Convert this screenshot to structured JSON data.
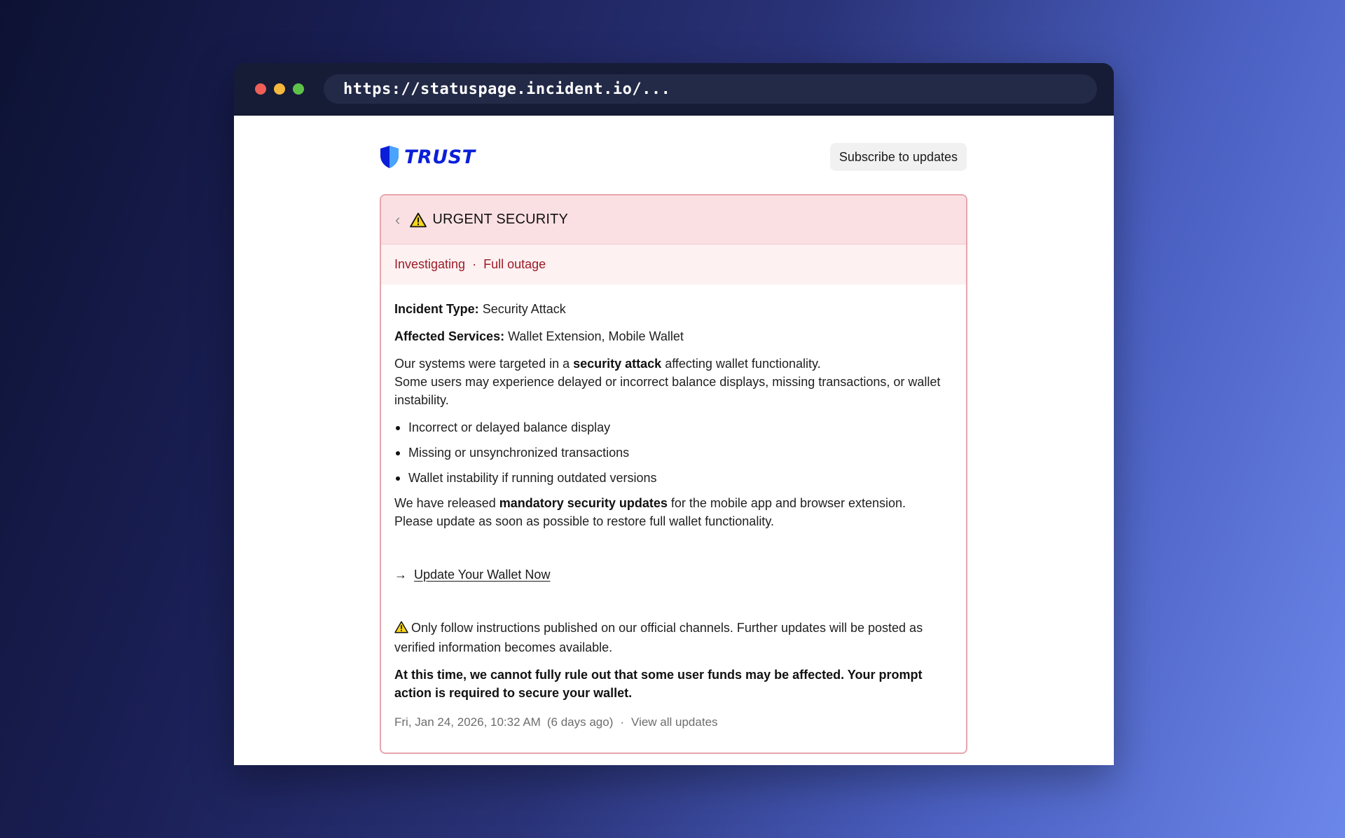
{
  "browser": {
    "url": "https://statuspage.incident.io/...",
    "dot_colors": [
      "#ee5f57",
      "#f5b83d",
      "#5ec24a"
    ]
  },
  "header": {
    "logo_text": "TRUST",
    "brand_color": "#0b1fd9",
    "subscribe_label": "Subscribe to updates"
  },
  "incident": {
    "title": "URGENT SECURITY",
    "status": "Investigating",
    "severity": "Full outage",
    "status_separator": "·",
    "type_label": "Incident Type:",
    "type_value": "Security Attack",
    "services_label": "Affected Services:",
    "services_value": "Wallet Extension, Mobile Wallet",
    "desc_part1": "Our systems were targeted in a ",
    "desc_bold": "security attack",
    "desc_part2": " affecting wallet functionality.",
    "desc_line2": "Some users may experience delayed or incorrect balance displays, missing transactions, or wallet instability.",
    "bullets": [
      "Incorrect or delayed balance display",
      "Missing or unsynchronized transactions",
      "Wallet instability if running outdated versions"
    ],
    "update_part1": "We have released ",
    "update_bold": "mandatory security updates",
    "update_part2": " for the mobile app and browser extension.",
    "update_line2": "Please update as soon as possible to restore full wallet functionality.",
    "cta_arrow": "→",
    "cta_label": "Update Your Wallet Now",
    "notice": "Only follow instructions published on our official channels. Further updates will be posted as verified information becomes available.",
    "warning_bold": "At this time, we cannot fully rule out that some user funds may be affected. Your prompt action is required to secure your wallet.",
    "date": "Fri, Jan 24, 2026, 10:32 AM",
    "ago": "(6 days ago)",
    "footer_separator": "·",
    "view_all": "View all updates"
  }
}
